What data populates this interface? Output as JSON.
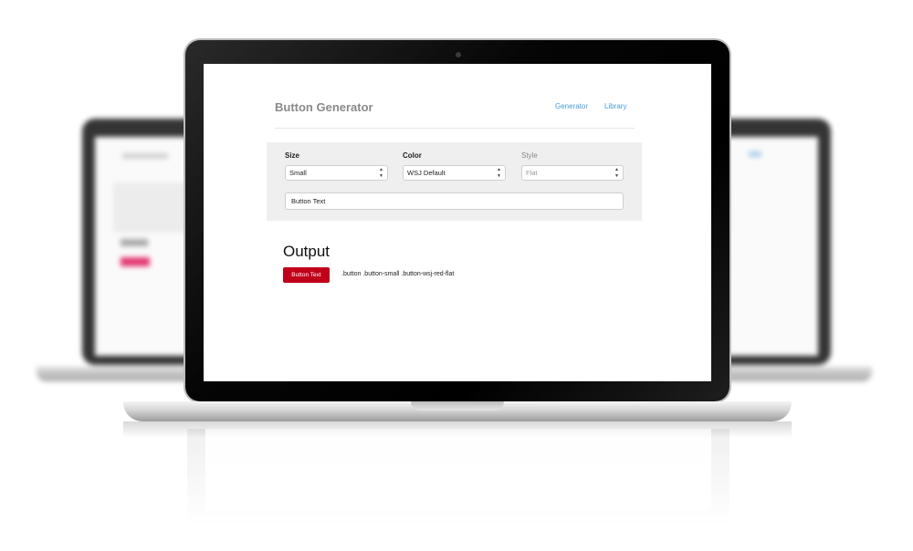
{
  "header": {
    "title": "Button Generator",
    "nav": [
      "Generator",
      "Library"
    ]
  },
  "form": {
    "size": {
      "label": "Size",
      "value": "Small"
    },
    "color": {
      "label": "Color",
      "value": "WSJ Default"
    },
    "style": {
      "label": "Style",
      "value": "Flat"
    },
    "text_input": {
      "value": "Button Text"
    }
  },
  "output": {
    "heading": "Output",
    "preview_button_label": "Button Text",
    "class_string": ".button .button-small .button-wsj-red-flat"
  },
  "colors": {
    "link": "#4a9bd8",
    "brand_red": "#c0001a",
    "panel_bg": "#efefef",
    "title_gray": "#8a8a8a"
  },
  "icons": {
    "select_arrow": "select-arrow-icon",
    "camera": "camera-icon"
  }
}
